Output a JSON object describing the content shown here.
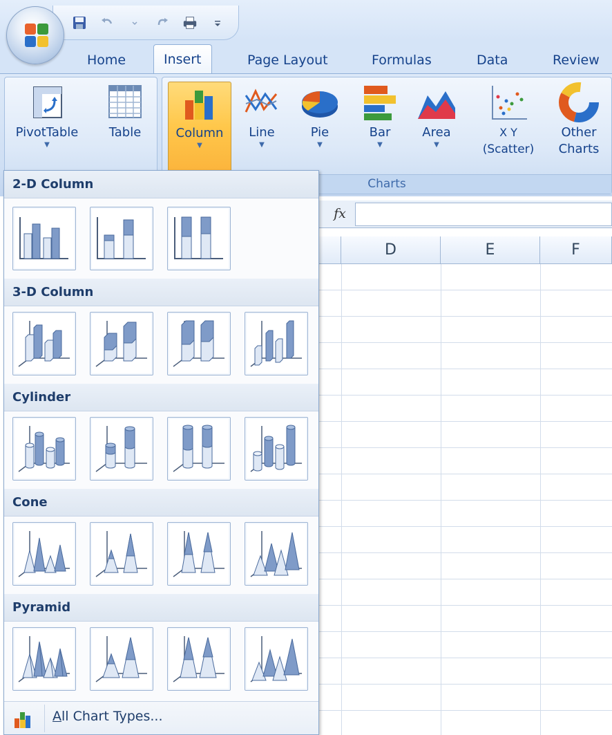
{
  "tabs": [
    "Home",
    "Insert",
    "Page Layout",
    "Formulas",
    "Data",
    "Review"
  ],
  "active_tab": "Insert",
  "ribbon": {
    "tables_buttons": [
      {
        "label": "PivotTable",
        "icon": "pivot-table-icon"
      },
      {
        "label": "Table",
        "icon": "table-icon"
      }
    ],
    "charts_buttons": [
      {
        "label": "Column",
        "icon": "column-chart-icon",
        "pressed": true
      },
      {
        "label": "Line",
        "icon": "line-chart-icon"
      },
      {
        "label": "Pie",
        "icon": "pie-chart-icon"
      },
      {
        "label": "Bar",
        "icon": "bar-chart-icon"
      },
      {
        "label": "Area",
        "icon": "area-chart-icon"
      },
      {
        "label": "X Y",
        "label2": "(Scatter)",
        "icon": "scatter-chart-icon"
      },
      {
        "label": "Other",
        "label2": "Charts",
        "icon": "other-charts-icon"
      }
    ],
    "charts_group_label": "Charts"
  },
  "formula_bar": {
    "fx_label": "fx",
    "value": ""
  },
  "columns": [
    "D",
    "E",
    "F"
  ],
  "dropdown": {
    "sections": [
      {
        "title": "2-D Column",
        "items": [
          "Clustered Column",
          "Stacked Column",
          "100% Stacked Column"
        ]
      },
      {
        "title": "3-D Column",
        "items": [
          "3-D Clustered Column",
          "3-D Stacked Column",
          "3-D 100% Stacked Column",
          "3-D Column"
        ]
      },
      {
        "title": "Cylinder",
        "items": [
          "Clustered Cylinder",
          "Stacked Cylinder",
          "100% Stacked Cylinder",
          "3-D Cylinder"
        ]
      },
      {
        "title": "Cone",
        "items": [
          "Clustered Cone",
          "Stacked Cone",
          "100% Stacked Cone",
          "3-D Cone"
        ]
      },
      {
        "title": "Pyramid",
        "items": [
          "Clustered Pyramid",
          "Stacked Pyramid",
          "100% Stacked Pyramid",
          "3-D Pyramid"
        ]
      }
    ],
    "footer_label": "All Chart Types...",
    "footer_icon": "column-chart-icon"
  },
  "colors": {
    "ribbon_bg": "#cfdff4",
    "tab_text": "#15428b",
    "pressed_button": "#ffc74a",
    "section_header_text": "#1e3d6b"
  }
}
